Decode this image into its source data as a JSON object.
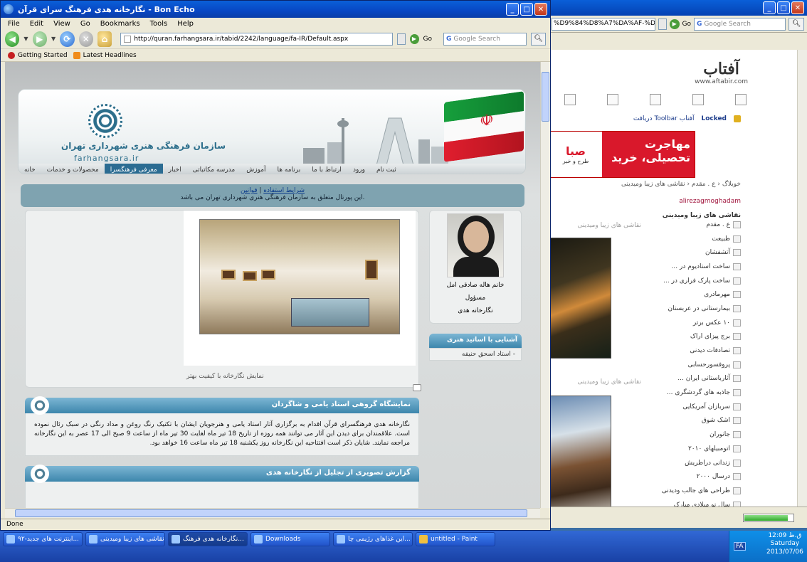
{
  "bg_window": {
    "url": "%D9%84%D8%A7%DA%AF-%D9%86",
    "go": "Go",
    "search_placeholder": "Google Search",
    "logo": "آفتاب",
    "logo_url": "www.aftabir.com",
    "locked": "Locked",
    "toolbar_link": "دریافت Toolbar آفتاب",
    "banner_left": "مهاجرت تحصیلی، خرید",
    "banner_right": "صبا",
    "banner_sub": "طرح و خبر",
    "breadcrumb": "خوبلاگ ‹ ع . مقدم ‹ نقاشی های زیبا ومیدینی",
    "author": "alirezagmoghadam",
    "post_title": "نقاشی های زیبا ومیدینی",
    "side_header": "ع . مقدم",
    "side_items": [
      "طبیعت",
      "آتشفشان",
      "ساخت استادیوم در ...",
      "ساخت پارک فراری در ...",
      "مهرمادری",
      "بیمارستانی در عربستان",
      "۱۰ عکس برتر",
      "برج پیزای اراک",
      "تصادفات دیدنی",
      "پروفسورحسابی",
      "آثارباستانی ایران ...",
      "جاذبه های گردشگری ...",
      "سربازان آمریکایی",
      "اشک شوق",
      "جانوران",
      "اتومبیلهای ۲۰۱۰",
      "زندانی دراطریش",
      "درسال ۲۰۰۰",
      "طراحی های جالب ودیدنی",
      "سال نو میلادی مبارک"
    ],
    "painting_caption_1": "نقاشی های زیبا ومیدینی",
    "painting_caption_2": "نقاشی های زیبا ومیدینی",
    "progress": 0.9
  },
  "window": {
    "title": "نگارخانه هدی فرهنگ سرای قرآن - Bon Echo",
    "menu": [
      "File",
      "Edit",
      "View",
      "Go",
      "Bookmarks",
      "Tools",
      "Help"
    ],
    "url": "http://quran.farhangsara.ir/tabid/2242/language/fa-IR/Default.aspx",
    "go": "Go",
    "search_placeholder": "Google Search",
    "bookmarks": [
      "Getting Started",
      "Latest Headlines"
    ],
    "status": "Done"
  },
  "page": {
    "logo_script": "سازمان فرهنگی هنری شهرداری تهران",
    "logo_domain": "farhangsara.ir",
    "nav": [
      "خانه",
      "محصولات و خدمات",
      "معرفی فرهنگسرا",
      "اخبار",
      "مدرسه مکاتباتی",
      "آموزش",
      "برنامه ها",
      "ارتباط با ما",
      "ورود",
      "ثبت نام"
    ],
    "nav_active_index": 2,
    "sub_links": [
      "شرایط استفاده",
      "قوانین"
    ],
    "sub_text": "این پورتال متعلق به سازمان فرهنگی هنری شهرداری تهران می باشد.",
    "gallery_caption": "نمایش نگارخانه با کیفیت بهتر",
    "section1_title": "نمایشگاه گروهی استاد یامی و شاگردان",
    "section1_body": "نگارخانه هدی فرهنگسرای قرآن اقدام به برگزاری آثار استاد یامی و هنرجویان ایشان با تکنیک رنگ روغن و مداد رنگی در سبک رئال نموده است. علاقمندان برای دیدن این آثار می توانند همه روزه از تاریخ 18 تیر ماه لغایت 30 تیر ماه از ساعت 9 صبح الی 17 عصر به این نگارخانه مراجعه نمایند. شایان ذکر است افتتاحیه این نگارخانه روز یکشنبه 18 تیر ماه ساعت 16 خواهد بود.",
    "section2_title": "گزارش تصویری از تجلیل از نگارخانه هدی",
    "profile_name": "خانم هاله صادقی امل",
    "profile_role": "مسؤول",
    "profile_org": "نگارخانه هدی",
    "asatid_title": "آشنایی با اساتید هنری",
    "asatid_item": "- استاد اسحق حنیفه"
  },
  "taskbar": {
    "tasks": [
      "اینترنت های جدید-۹۲...",
      "نقاشی های زیبا ومیدینی...",
      "نگارخانه هدی فرهنگ...",
      "Downloads",
      "این غذاهای رژیمی چا...",
      "untitled - Paint"
    ],
    "active_index": 2,
    "lang": "FA",
    "time": "ق.ظ 12:09",
    "day": "Saturday",
    "date": "2013/07/06"
  }
}
